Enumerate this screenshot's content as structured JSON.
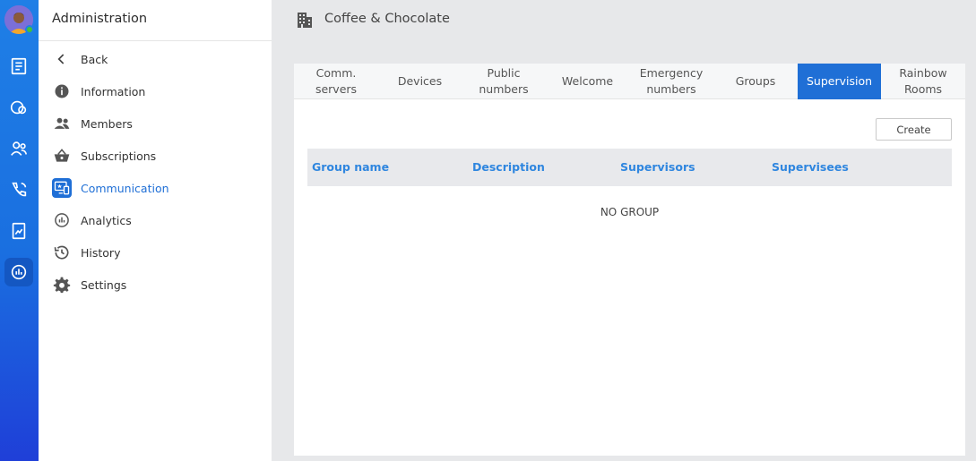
{
  "sidebar": {
    "title": "Administration",
    "items": [
      {
        "label": "Back",
        "icon": "back-arrow-icon"
      },
      {
        "label": "Information",
        "icon": "info-icon"
      },
      {
        "label": "Members",
        "icon": "members-icon"
      },
      {
        "label": "Subscriptions",
        "icon": "basket-icon"
      },
      {
        "label": "Communication",
        "icon": "communication-icon",
        "active": true
      },
      {
        "label": "Analytics",
        "icon": "analytics-icon"
      },
      {
        "label": "History",
        "icon": "history-icon"
      },
      {
        "label": "Settings",
        "icon": "gear-icon"
      }
    ]
  },
  "header": {
    "title": "Coffee & Chocolate",
    "icon": "building-icon"
  },
  "tabs": [
    {
      "label": "Comm.\nservers"
    },
    {
      "label": "Devices"
    },
    {
      "label": "Public\nnumbers"
    },
    {
      "label": "Welcome"
    },
    {
      "label": "Emergency\nnumbers"
    },
    {
      "label": "Groups"
    },
    {
      "label": "Supervision",
      "active": true
    },
    {
      "label": "Rainbow\nRooms"
    }
  ],
  "toolbar": {
    "create_label": "Create"
  },
  "table": {
    "columns": [
      "Group name",
      "Description",
      "Supervisors",
      "Supervisees"
    ],
    "empty_text": "NO GROUP"
  },
  "colors": {
    "accent": "#1f6fd6",
    "rail": "#1f7fe6",
    "presence": "#41c23b"
  }
}
